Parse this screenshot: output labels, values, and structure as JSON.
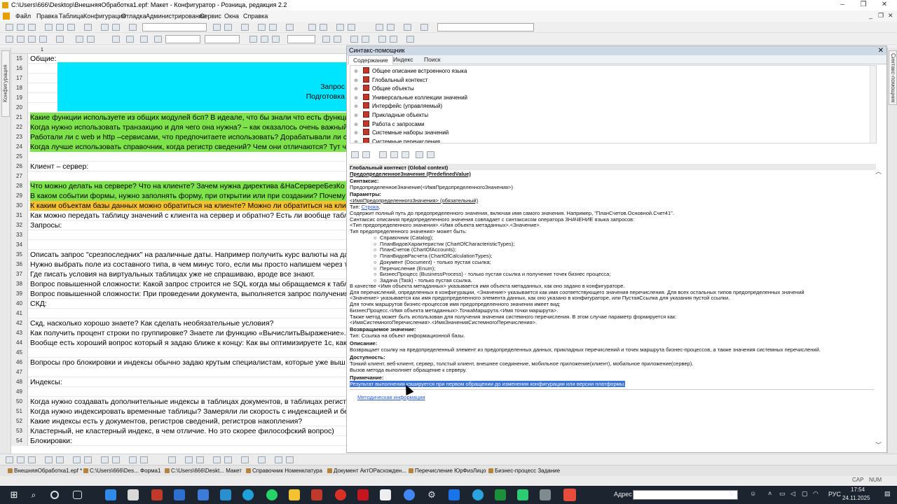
{
  "window": {
    "title": "C:\\Users\\666\\Desktop\\ВнешняяОбработка1.epf: Макет - Конфигуратор - Розница, редакция 2.2"
  },
  "menu": [
    "Файл",
    "Правка",
    "Таблица",
    "Конфигурация",
    "Отладка",
    "Администрирование",
    "Сервис",
    "Окна",
    "Справка"
  ],
  "left_panel_label": "Конфигурация",
  "sheet": {
    "column_header": "1",
    "rows": [
      {
        "num": "15",
        "text": "Общие:",
        "hl": ""
      },
      {
        "num": "16",
        "text": "",
        "hl": ""
      },
      {
        "num": "17",
        "text": "",
        "hl": ""
      },
      {
        "num": "18",
        "text": "",
        "hl": ""
      },
      {
        "num": "19",
        "text": "",
        "hl": ""
      },
      {
        "num": "20",
        "text": "",
        "hl": ""
      },
      {
        "num": "21",
        "text": "Какие функции используете из общих модулей бсп? В идеале, что бы знали что есть функции",
        "hl": "green"
      },
      {
        "num": "22",
        "text": "Когда нужно использовать транзакцию и для чего она нужна? – как оказалось очень важный",
        "hl": "green"
      },
      {
        "num": "23",
        "text": "Работали ли с web и http –сервисами, что предпочитаете использовать? Дорабатывали ли с",
        "hl": "green"
      },
      {
        "num": "24",
        "text": "Когда лучше использовать справочник, когда регистр сведений? Чем они отличаются? Тут ч",
        "hl": "green"
      },
      {
        "num": "25",
        "text": "",
        "hl": ""
      },
      {
        "num": "26",
        "text": "Клиент – сервер:",
        "hl": ""
      },
      {
        "num": "27",
        "text": "",
        "hl": ""
      },
      {
        "num": "28",
        "text": "Что можно делать на сервере? Что на клиенте? Зачем нужна директива &НаСервереБезКо",
        "hl": "green"
      },
      {
        "num": "29",
        "text": "В каком событии формы, нужно заполнять форму, при открытии или при создании? Почему т",
        "hl": "green"
      },
      {
        "num": "30",
        "text": "К каким объектам базы данных можно обратиться на клиенте? Можно ли обратиться на клие",
        "hl": "orange"
      },
      {
        "num": "31",
        "text": "Как можно передать таблицу значений с клиента на сервер и обратно? Есть ли вообще табл",
        "hl": ""
      },
      {
        "num": "32",
        "text": "Запросы:",
        "hl": ""
      },
      {
        "num": "33",
        "text": "",
        "hl": ""
      },
      {
        "num": "34",
        "text": "",
        "hl": ""
      },
      {
        "num": "35",
        "text": "Описать запрос \"срезпоследних\" на различные даты. Например получить курс валюты на дат",
        "hl": ""
      },
      {
        "num": "36",
        "text": "Нужно выбрать поле из составного типа, в чем минус того, если мы просто напишем через то",
        "hl": ""
      },
      {
        "num": "37",
        "text": "Где писать условия на виртуальных таблицах уже не спрашиваю, вроде все знают.",
        "hl": ""
      },
      {
        "num": "38",
        "text": "Вопрос повышенной сложности: Какой запрос строится не SQL когда мы обращаемся к табл",
        "hl": ""
      },
      {
        "num": "39",
        "text": "Вопрос повышенной сложности: При проведении документа, выполняется запрос получения",
        "hl": ""
      },
      {
        "num": "40",
        "text": "СКД:",
        "hl": ""
      },
      {
        "num": "41",
        "text": "",
        "hl": ""
      },
      {
        "num": "42",
        "text": "Скд, насколько хорошо знаете? Как сделать необязательные условия?",
        "hl": ""
      },
      {
        "num": "43",
        "text": "Как получить процент строки по группировке? Знаете ли функцию «ВычислитьВыражение».",
        "hl": ""
      },
      {
        "num": "44",
        "text": "Вообще есть хороший вопрос который я задаю ближе к концу: Как вы оптимизируете 1с, как",
        "hl": ""
      },
      {
        "num": "45",
        "text": "",
        "hl": ""
      },
      {
        "num": "46",
        "text": "Вопросы про блокировки и индексы обычно задаю крутым специалистам, которые уже выш",
        "hl": ""
      },
      {
        "num": "47",
        "text": "",
        "hl": ""
      },
      {
        "num": "48",
        "text": "Индексы:",
        "hl": ""
      },
      {
        "num": "49",
        "text": "",
        "hl": ""
      },
      {
        "num": "50",
        "text": "Когда нужно создавать дополнительные индексы в таблицах документов, в таблицах регистр",
        "hl": ""
      },
      {
        "num": "51",
        "text": "Когда нужно индексировать временные таблицы? Замеряли ли скорость с индексацией и бе",
        "hl": ""
      },
      {
        "num": "52",
        "text": "Какие индексы есть у документов, регистров сведений, регистров накопления?",
        "hl": ""
      },
      {
        "num": "53",
        "text": "Кластерный, не кластерный индекс, в чем отличие. Но это скорее философский вопрос)",
        "hl": ""
      },
      {
        "num": "54",
        "text": "Блокировки:",
        "hl": ""
      }
    ],
    "cyan_line1": "Запрос",
    "cyan_line2": "Подготовка"
  },
  "syntax_helper": {
    "title": "Синтакс-помощник",
    "tabs": [
      "Содержание",
      "Индекс",
      "Поиск"
    ],
    "tree": [
      "Общее описание встроенного языка",
      "Глобальный контекст",
      "Общие объекты",
      "Универсальные коллекции значений",
      "Интерфейс (управляемый)",
      "Прикладные объекты",
      "Работа с запросами",
      "Системные наборы значений",
      "Системные перечисления"
    ],
    "content": {
      "header": "Глобальный контекст (Global context)",
      "method": "ПредопределенноеЗначение (PredefinedValue)",
      "syntax_label": "Синтаксис:",
      "syntax": "ПредопределенноеЗначение(<ИмяПредопределенногоЗначения>)",
      "params_label": "Параметры:",
      "param": "<ИмяПредопределенногоЗначения> (обязательный)",
      "type_prefix": "Тип: ",
      "type_link": "Строка",
      "type_suffix": ".",
      "lines": [
        "Содержит полный путь до предопределенного значения, включая имя самого значения. Например, \"ПланСчетов.Основной.Счет41\".",
        "Синтаксис описания предопределенного значения совпадает с синтаксисом оператора ЗНАЧЕНИЕ языка запросов:",
        "<Тип предопределенного значения>.<Имя объекта метаданных>.<Значение>.",
        "Тип предопределенного значения> может быть:"
      ],
      "bullets": [
        "Справочник (Catalog);",
        "ПланВидовХарактеристик (ChartOfCharacteristicTypes);",
        "ПланСчетов (ChartOfAccounts);",
        "ПланВидовРасчета (ChartOfCalculationTypes);",
        "Документ (Document) - только пустая ссылка;",
        "Перечисление (Enum);",
        "БизнесПроцесс (BusinessProcess) - только пустая ссылка и получение точек бизнес процесса;",
        "Задача (Task) - только пустая ссылка."
      ],
      "lines2": [
        "В качестве <Имя объекта метаданных> указывается имя объекта метаданных, как оно задано в конфигураторе.",
        "Для перечислений, определенных в конфигурации, <Значение> указывается как имя соответствующего значения перечисления. Для всех остальных типов предопределенных значений",
        "<Значение> указывается как имя предопределенного элемента данных, как оно указано в конфигураторе, или ПустаяСсылка для указания пустой ссылки.",
        "Для точек маршрутов бизнес-процессов имя предопределенного значения имеет вид:",
        "БизнесПроцесс.<Имя объекта метаданных>.ТочкаМаршрута.<Имя точки маршрута>.",
        "Также метод может быть использован для получения значения системного перечисления. В этом случае параметр формируется как:",
        "<ИмяСистемногоПеречисления>.<ИмяЗначенияСистемногоПеречисления>."
      ],
      "return_label": "Возвращаемое значение:",
      "return_text": "Тип: Ссылка на объект информационной базы.",
      "desc_label": "Описание:",
      "desc_text": "Возвращает ссылку на предопределенный элемент из предопределенных данных, прикладных перечислений и точек маршрута бизнес-процессов, а также значения системных перечислений.",
      "avail_label": "Доступность:",
      "avail_text": "Тонкий клиент, веб-клиент, сервер, толстый клиент, внешнее соединение, мобильное приложение(клиент), мобильное приложение(сервер).",
      "avail_text2": "Вызов метода выполняет обращение к серверу.",
      "note_label": "Примечание:",
      "note_text": "Результат выполнения кэшируется при первом обращении до изменения конфигурации или версии платформы.",
      "method_link": "Методическая информация"
    }
  },
  "open_windows": [
    "ВнешняяОбработка1.epf *",
    "C:\\Users\\666\\Des... Форма1",
    "C:\\Users\\666\\Deskt... Макет",
    "Справочник Номенклатура",
    "Документ АктОРасхожден...",
    "Перечисление ЮрФизЛицо",
    "Бизнес-процесс Задание"
  ],
  "status": {
    "cap": "CAP",
    "num": "NUM"
  },
  "taskbar": {
    "address_label": "Адрес",
    "lang": "РУС",
    "time": "17:54",
    "date": "24.11.2025"
  }
}
